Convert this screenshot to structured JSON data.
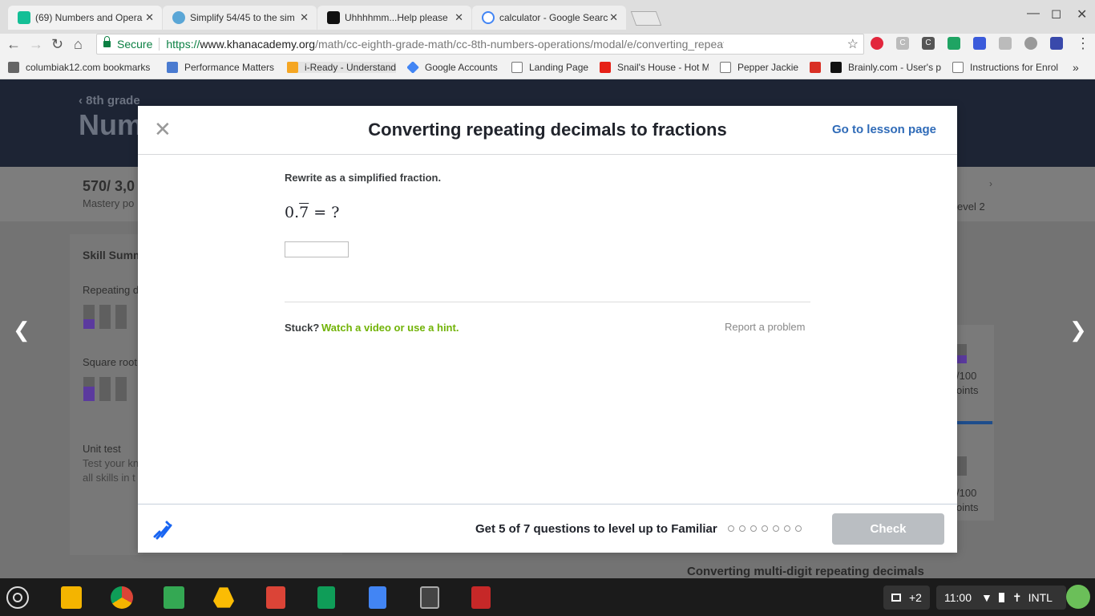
{
  "browser": {
    "tabs": [
      {
        "title": "(69) Numbers and Opera",
        "icon": "khan-academy-icon",
        "active": true
      },
      {
        "title": "Simplify 54/45 to the sim",
        "icon": "mathway-icon",
        "active": false
      },
      {
        "title": "Uhhhhmm...Help please",
        "icon": "brainly-icon",
        "active": false
      },
      {
        "title": "calculator - Google Searc",
        "icon": "google-icon",
        "active": false
      }
    ],
    "tab_close": "✕",
    "address": {
      "secure_label": "Secure",
      "protocol": "https://",
      "host": "www.khanacademy.org",
      "path": "/math/cc-eighth-grade-math/cc-8th-numbers-operations/modal/e/converting_repeating_decimals_to_..."
    },
    "bookmarks": [
      "columbiak12.com bookmarks",
      "Performance Matters",
      "i-Ready - Understandi",
      "Google Accounts",
      "Landing Page",
      "Snail's House - Hot M",
      "Pepper Jackie",
      "Brainly.com - User's p",
      "Instructions for Enrol"
    ],
    "bookmarks_more": "»"
  },
  "background_page": {
    "breadcrumb": "8th grade",
    "title_partial": "Num",
    "mastery_points": "570/ 3,0",
    "mastery_label": "Mastery po",
    "skill_summary": "Skill Summ",
    "skill_1": "Repeating d",
    "skill_2": "Square root",
    "unit_test_title": "Unit test",
    "unit_test_desc_1": "Test your kn",
    "unit_test_desc_2": "all skills in t",
    "level_label": "evel 2",
    "points_1": "/100",
    "points_1_label": "oints",
    "points_2": "/100",
    "points_2_label": "oints",
    "next_card_title": "Converting multi-digit repeating decimals"
  },
  "modal": {
    "title": "Converting repeating decimals to fractions",
    "lesson_link": "Go to lesson page",
    "instructions": "Rewrite as a simplified fraction.",
    "equation_prefix": "0.",
    "equation_repeat": "7",
    "equation_suffix": " = ?",
    "answer_value": "",
    "stuck_label": "Stuck?",
    "hint_link": "Watch a video or use a hint.",
    "report_link": "Report a problem",
    "level_up_text": "Get 5 of 7 questions to level up to Familiar",
    "progress_total": 7,
    "progress_done": 0,
    "check_label": "Check"
  },
  "taskbar": {
    "notification_count": "+2",
    "time": "11:00",
    "input_method": "INTL"
  }
}
